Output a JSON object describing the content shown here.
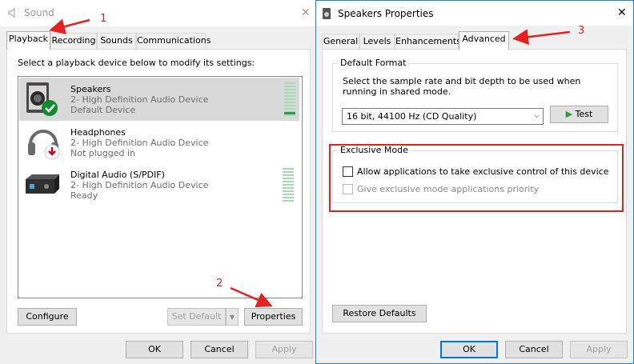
{
  "sound": {
    "title": "Sound",
    "close": "✕",
    "tabs": [
      {
        "label": "Playback"
      },
      {
        "label": "Recording"
      },
      {
        "label": "Sounds"
      },
      {
        "label": "Communications"
      }
    ],
    "instruction": "Select a playback device below to modify its settings:",
    "devices": [
      {
        "name": "Speakers",
        "line1": "2- High Definition Audio Device",
        "line2": "Default Device"
      },
      {
        "name": "Headphones",
        "line1": "2- High Definition Audio Device",
        "line2": "Not plugged in"
      },
      {
        "name": "Digital Audio (S/PDIF)",
        "line1": "2- High Definition Audio Device",
        "line2": "Ready"
      }
    ],
    "configure_label": "Configure",
    "set_default_label": "Set Default",
    "properties_label": "Properties",
    "ok_label": "OK",
    "cancel_label": "Cancel",
    "apply_label": "Apply"
  },
  "props": {
    "title": "Speakers Properties",
    "close": "✕",
    "tabs": [
      {
        "label": "General"
      },
      {
        "label": "Levels"
      },
      {
        "label": "Enhancements"
      },
      {
        "label": "Advanced"
      }
    ],
    "default_format": {
      "group_label": "Default Format",
      "description": "Select the sample rate and bit depth to be used when running in shared mode.",
      "selected_format": "16 bit, 44100 Hz (CD Quality)",
      "test_label": "Test"
    },
    "exclusive_mode": {
      "group_label": "Exclusive Mode",
      "allow_label": "Allow applications to take exclusive control of this device",
      "priority_label": "Give exclusive mode applications priority"
    },
    "restore_label": "Restore Defaults",
    "ok_label": "OK",
    "cancel_label": "Cancel",
    "apply_label": "Apply"
  },
  "annotations": {
    "step1": "1",
    "step2": "2",
    "step3": "3"
  },
  "colors": {
    "annotation_red": "#e52222",
    "accent_blue": "#0078d7",
    "meter_green": "#a6dbb6"
  }
}
